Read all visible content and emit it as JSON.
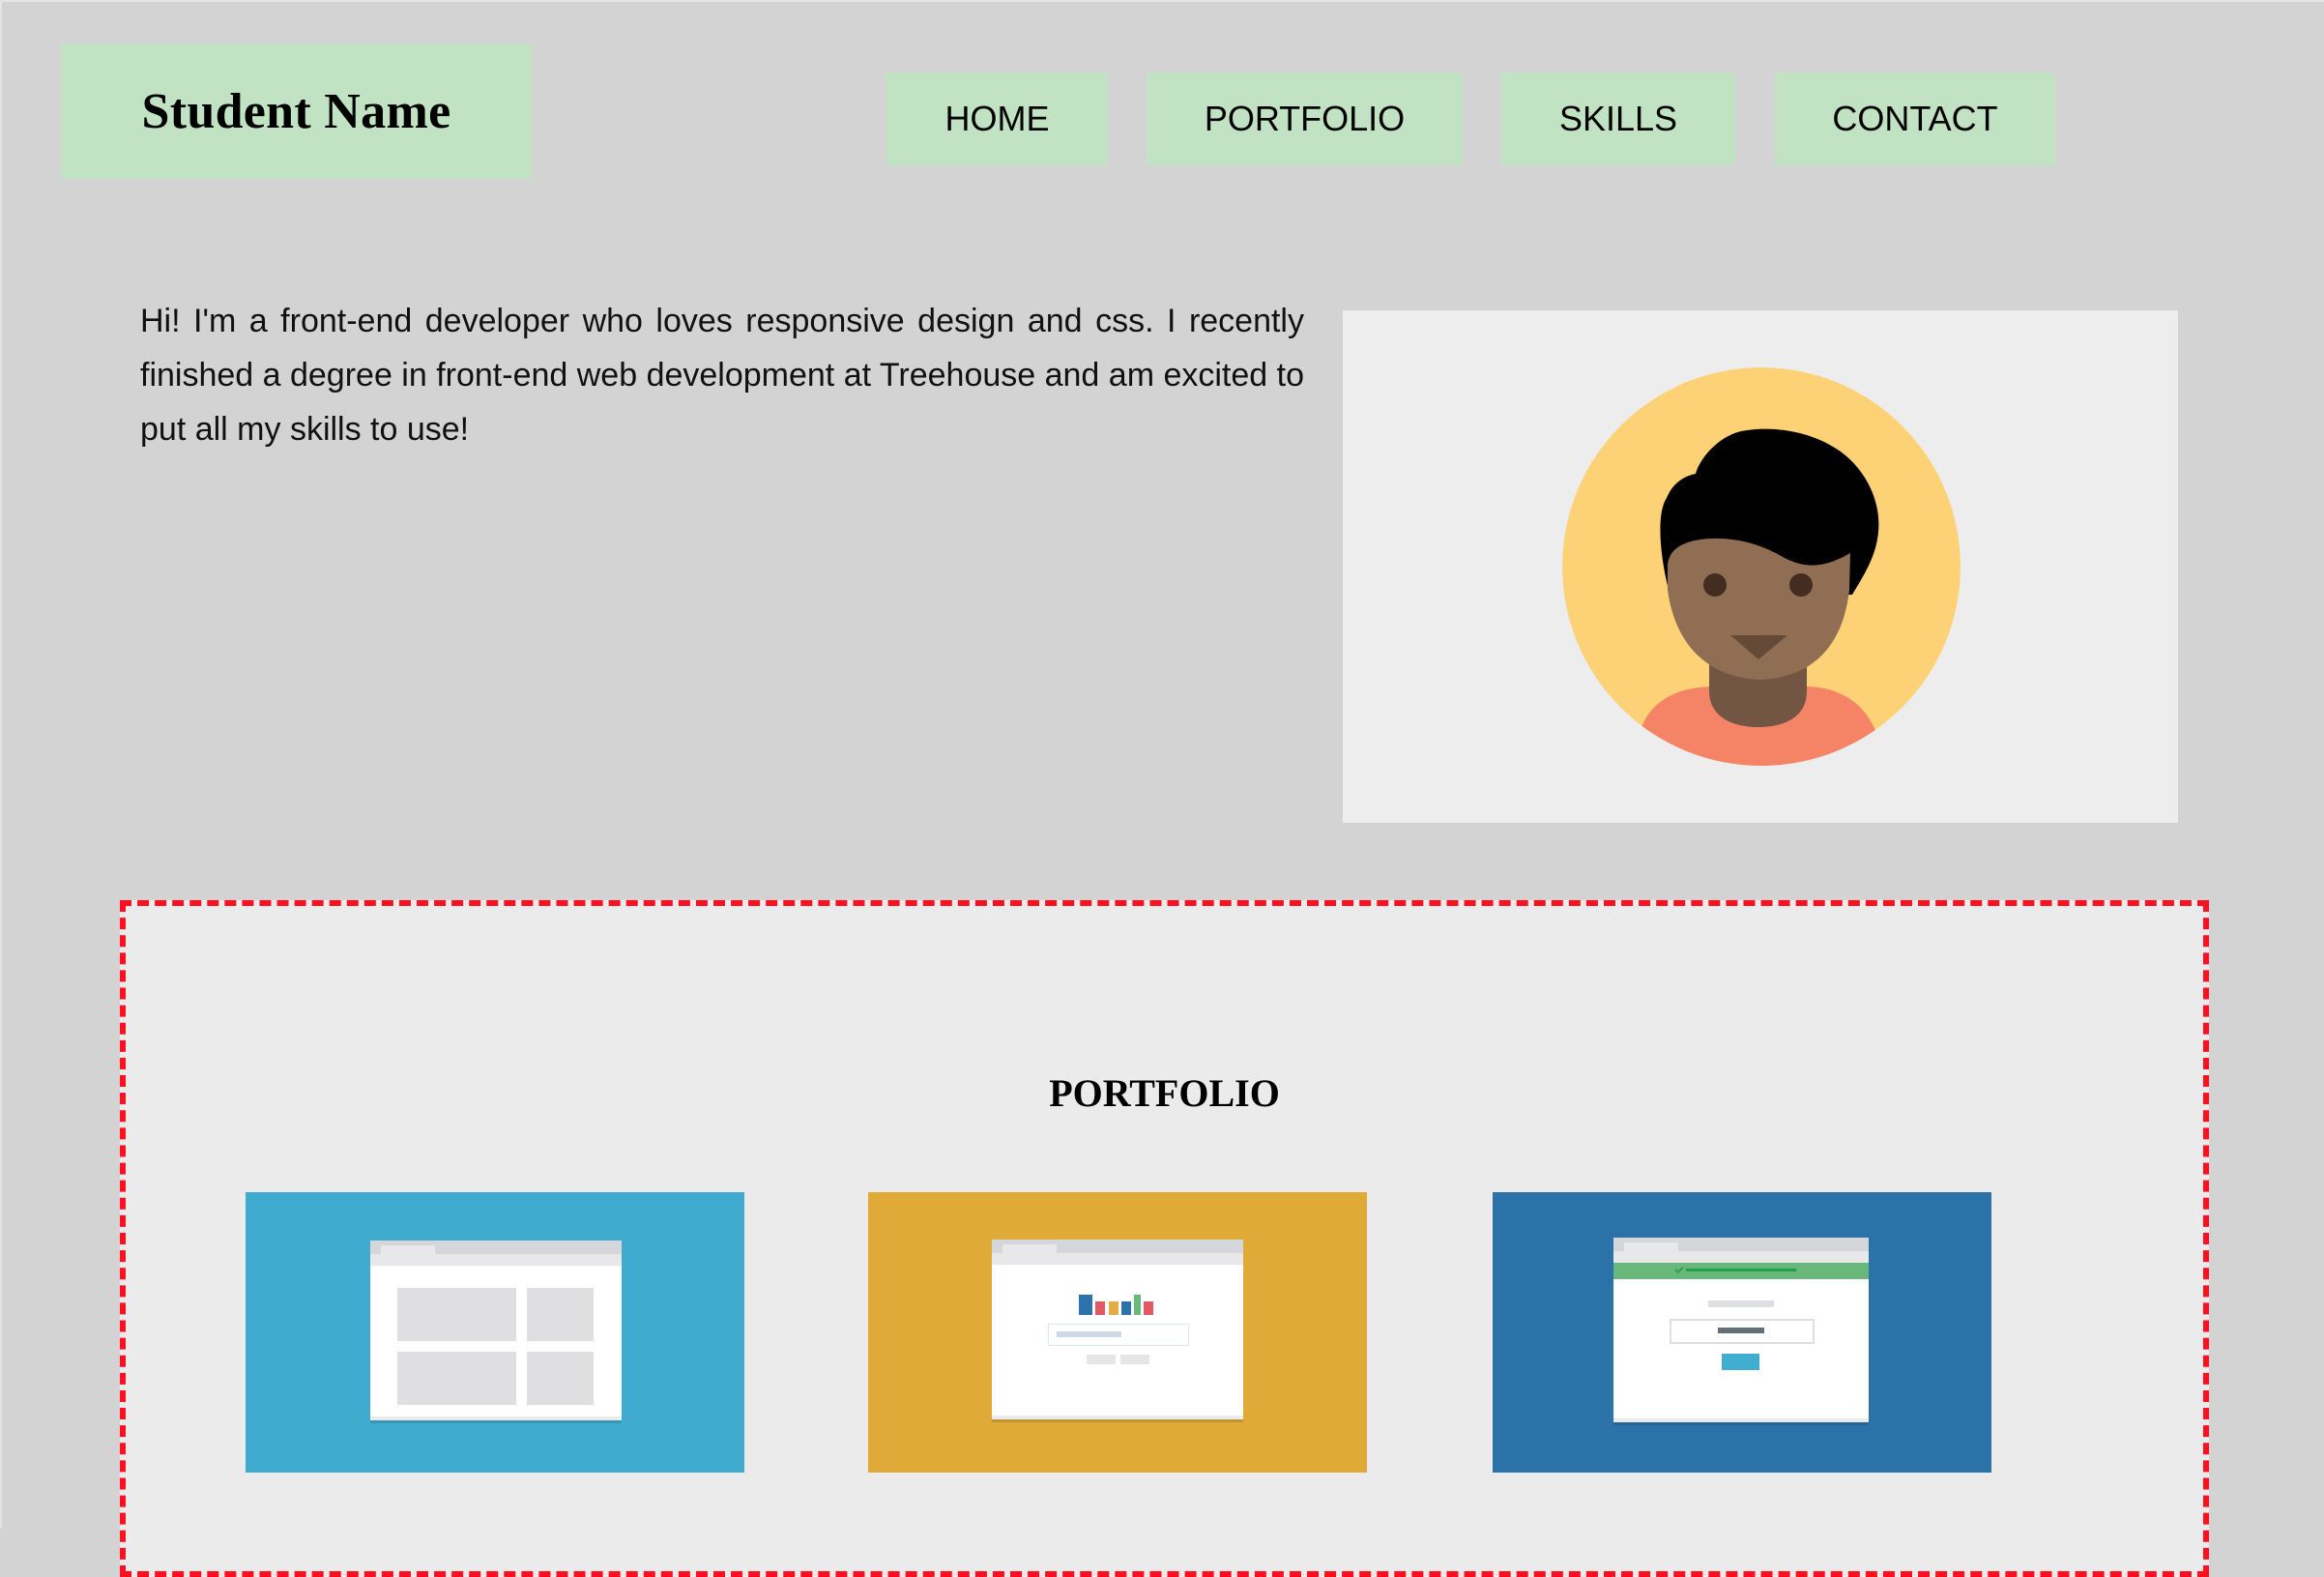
{
  "header": {
    "logo_text": "Student Name",
    "nav": [
      {
        "label": "HOME"
      },
      {
        "label": "PORTFOLIO"
      },
      {
        "label": "SKILLS"
      },
      {
        "label": "CONTACT"
      }
    ]
  },
  "intro": {
    "text": "Hi! I'm a front-end developer who loves responsive design and css. I recently finished a degree in front-end web development at Treehouse and am excited to put all my skills to use!",
    "avatar_icon": "person-avatar-icon"
  },
  "portfolio": {
    "title": "PORTFOLIO",
    "projects": [
      {
        "name": "layout-grid-project",
        "color": "#3fabcf"
      },
      {
        "name": "search-app-project",
        "color": "#dfaa38"
      },
      {
        "name": "form-success-project",
        "color": "#2b72a8"
      }
    ]
  },
  "colors": {
    "page_bg": "#d3d3d3",
    "nav_bg": "#c2e3c3",
    "section_border": "#ff0f1f",
    "section_bg": "#ebebeb",
    "avatar_bg": "#fdd176",
    "shirt": "#f48465"
  }
}
